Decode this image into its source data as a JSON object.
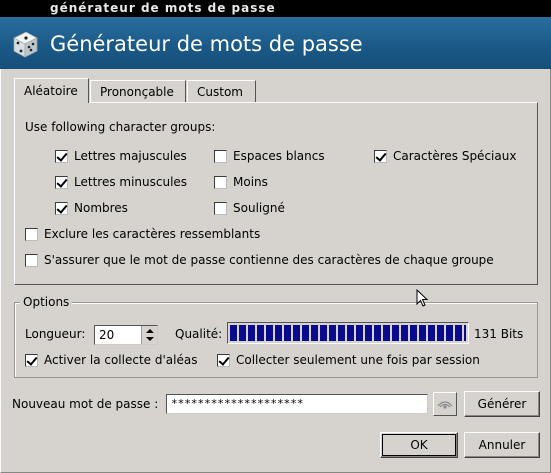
{
  "window": {
    "titlebar_text": "générateur de mots de passe",
    "header_title": "Générateur de mots de passe",
    "header_icon": "dice-icon"
  },
  "tabs": [
    {
      "label": "Aléatoire",
      "active": true
    },
    {
      "label": "Prononçable",
      "active": false
    },
    {
      "label": "Custom",
      "active": false
    }
  ],
  "random_tab": {
    "groups_label": "Use following character groups:",
    "uppercase": {
      "label": "Lettres majuscules",
      "checked": true
    },
    "lowercase": {
      "label": "Lettres minuscules",
      "checked": true
    },
    "numbers": {
      "label": "Nombres",
      "checked": true
    },
    "spaces": {
      "label": "Espaces blancs",
      "checked": false
    },
    "minus": {
      "label": "Moins",
      "checked": false
    },
    "underscore": {
      "label": "Souligné",
      "checked": false
    },
    "special": {
      "label": "Caractères Spéciaux",
      "checked": true
    },
    "exclude_similar": {
      "label": "Exclure les caractères ressemblants",
      "checked": false
    },
    "each_group": {
      "label": "S'assurer que le mot de passe contienne des caractères de chaque groupe",
      "checked": false
    }
  },
  "options": {
    "title": "Options",
    "length_label": "Longueur:",
    "length_value": "20",
    "quality_label": "Qualité:",
    "quality_fraction": 1.0,
    "quality_bits": "131 Bits",
    "entropy": {
      "label": "Activer la collecte d'aléas",
      "checked": true
    },
    "once_per_session": {
      "label": "Collecter seulement une fois par session",
      "checked": true
    }
  },
  "new_password": {
    "label": "Nouveau mot de passe :",
    "value": "********************",
    "generate_label": "Générer"
  },
  "buttons": {
    "ok": "OK",
    "cancel": "Annuler"
  }
}
